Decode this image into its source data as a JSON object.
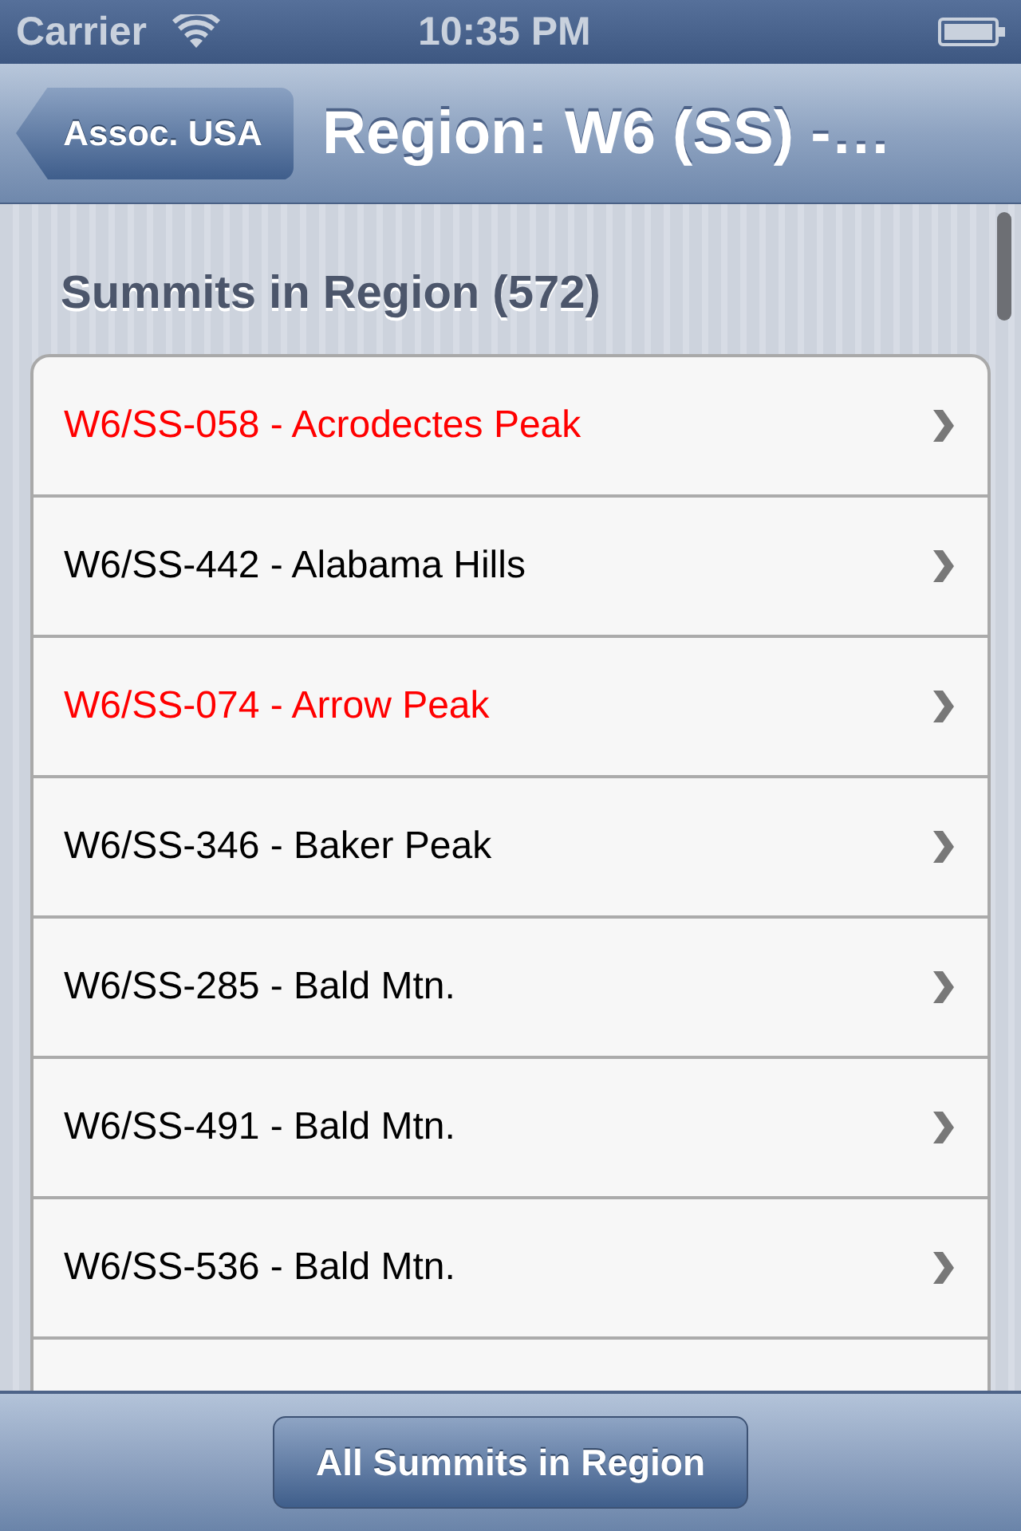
{
  "status_bar": {
    "carrier": "Carrier",
    "time": "10:35 PM"
  },
  "nav_bar": {
    "back_button": "Assoc. USA",
    "title": "Region: W6 (SS) -…"
  },
  "section": {
    "header": "Summits in Region (572)"
  },
  "summits": [
    {
      "label": "W6/SS-058 - Acrodectes Peak",
      "color": "#ff0000"
    },
    {
      "label": "W6/SS-442 - Alabama Hills",
      "color": "#000000"
    },
    {
      "label": "W6/SS-074 - Arrow Peak",
      "color": "#ff0000"
    },
    {
      "label": "W6/SS-346 - Baker Peak",
      "color": "#000000"
    },
    {
      "label": "W6/SS-285 - Bald Mtn.",
      "color": "#000000"
    },
    {
      "label": "W6/SS-491 - Bald Mtn.",
      "color": "#000000"
    },
    {
      "label": "W6/SS-536 - Bald Mtn.",
      "color": "#000000"
    }
  ],
  "toolbar": {
    "button": "All Summits in Region"
  }
}
